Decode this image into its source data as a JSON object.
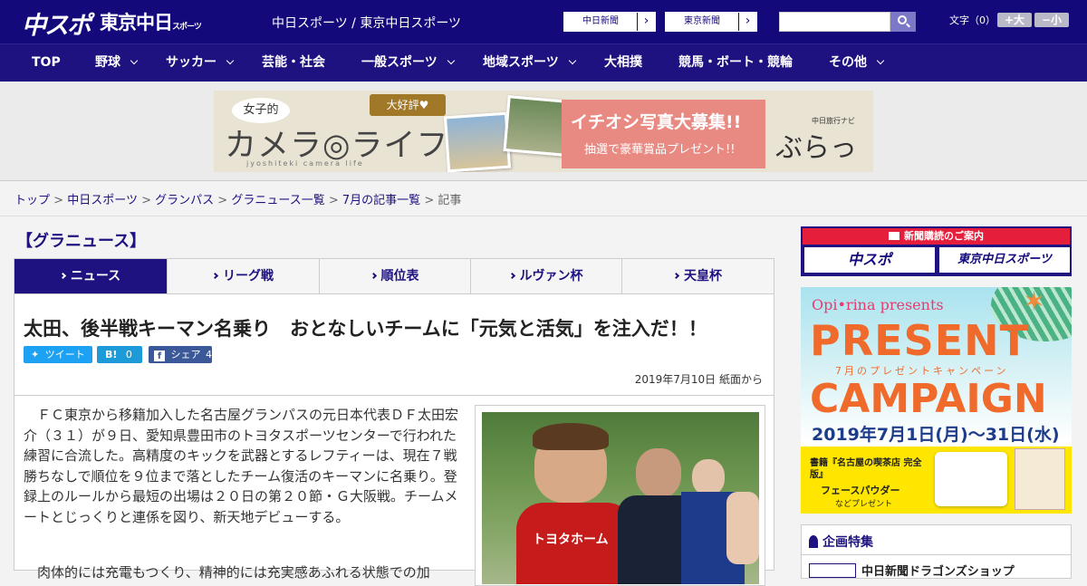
{
  "header": {
    "logo_main": "中スポ",
    "logo_sub": "東京中日",
    "logo_sub_small": "スポーツ",
    "site_links": "中日スポーツ / 東京中日スポーツ",
    "paper_buttons": [
      "中日新聞",
      "東京新聞"
    ],
    "font_label": "文字（0）",
    "font_up": "+大",
    "font_down": "−小"
  },
  "nav": {
    "items": [
      "TOP",
      "野球",
      "サッカー",
      "芸能・社会",
      "一般スポーツ",
      "地域スポーツ",
      "大相撲",
      "競馬・ボート・競輪",
      "その他"
    ]
  },
  "banner": {
    "bubble": "女子的",
    "title": "カメラ◎ライフ",
    "subtitle": "jyoshiteki camera life",
    "tag": "大好評♥",
    "headline": "イチオシ写真大募集!!",
    "sub": "抽選で豪華賞品プレゼント!!",
    "brand_small": "中日旅行ナビ",
    "brand": "ぶらっ人"
  },
  "breadcrumb": {
    "links": [
      "トップ",
      "中日スポーツ",
      "グランパス",
      "グラニュース一覧",
      "7月の記事一覧"
    ],
    "current": "記事",
    "separator": ">"
  },
  "section_title": "【グラニュース】",
  "tabs": [
    "ニュース",
    "リーグ戦",
    "順位表",
    "ルヴァン杯",
    "天皇杯"
  ],
  "article": {
    "headline": "太田、後半戦キーマン名乗り　おとなしいチームに「元気と活気」を注入だ！！",
    "share": {
      "tweet": "ツイート",
      "hatena_count": "0",
      "facebook": "シェア",
      "facebook_count": "4"
    },
    "date": "2019年7月10日 紙面から",
    "body_p1": "ＦＣ東京から移籍加入した名古屋グランパスの元日本代表ＤＦ太田宏介（３１）が９日、愛知県豊田市のトヨタスポーツセンターで行われた練習に合流した。高精度のキックを武器とするレフティーは、現在７戦勝ちなしで順位を９位まで落としたチーム復活のキーマンに名乗り。登録上のルールから最短の出場は２０日の第２０節・Ｇ大阪戦。チームメートとじっくりと連係を図り、新天地デビューする。",
    "body_p2": "肉体的には充電もつくり、精神的には充実感あふれる状態での加",
    "photo_shirt": "トヨタホーム"
  },
  "sidebar": {
    "subscribe_head": "新聞購読のご案内",
    "subscribe_logos": [
      "中スポ",
      "東京中日スポーツ"
    ],
    "campaign": {
      "brand": "Opi•rina presents",
      "line1": "PRESENT",
      "line2": "7月のプレゼントキャンペーン",
      "line3": "CAMPAIGN",
      "dates": "2019年7月1日(月)〜31日(水)",
      "gift1": "書籍『名古屋の喫茶店 完全版』",
      "gift2": "フェースパウダー",
      "gift3": "などプレゼント"
    },
    "feature_title": "企画特集",
    "feature_item": "中日新聞ドラゴンズショップ"
  },
  "colors": {
    "brand_navy": "#13097a",
    "nav": "#1d127f",
    "accent_red": "#e41e3b",
    "campaign_orange": "#f06a2c"
  }
}
